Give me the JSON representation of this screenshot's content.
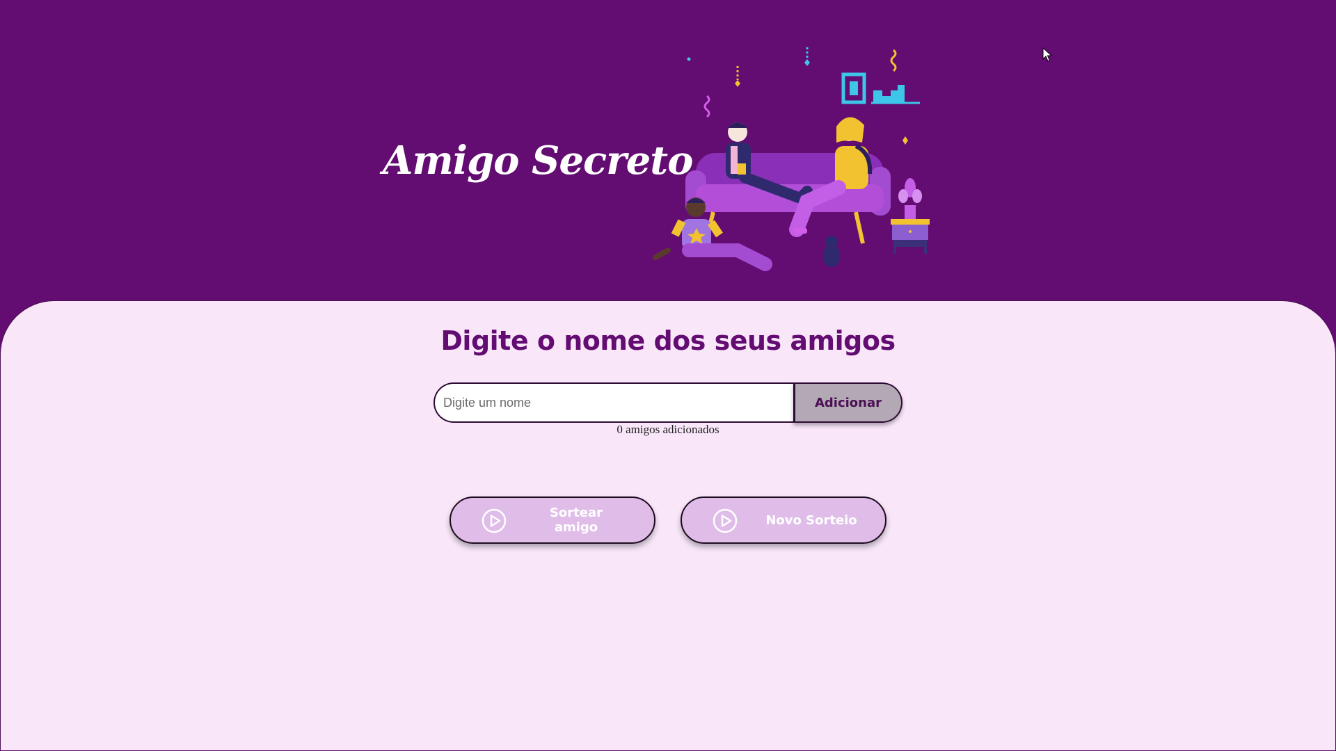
{
  "header": {
    "title": "Amigo Secreto",
    "illustration_icon": "friends-party-illustration"
  },
  "main": {
    "heading": "Digite o nome dos seus amigos",
    "name_input": {
      "placeholder": "Digite um nome",
      "value": ""
    },
    "add_button_label": "Adicionar",
    "friends_count_text": "0 amigos adicionados",
    "draw_button": {
      "label": "Sortear amigo",
      "icon": "play-circle-icon"
    },
    "new_draw_button": {
      "label": "Novo Sorteio",
      "icon": "play-circle-icon"
    }
  },
  "colors": {
    "brand_purple": "#630c72",
    "panel_background": "#f9e7f9",
    "action_button_fill": "#e0bde9",
    "add_button_fill": "#b3a9b4",
    "heading_text": "#630c72"
  }
}
